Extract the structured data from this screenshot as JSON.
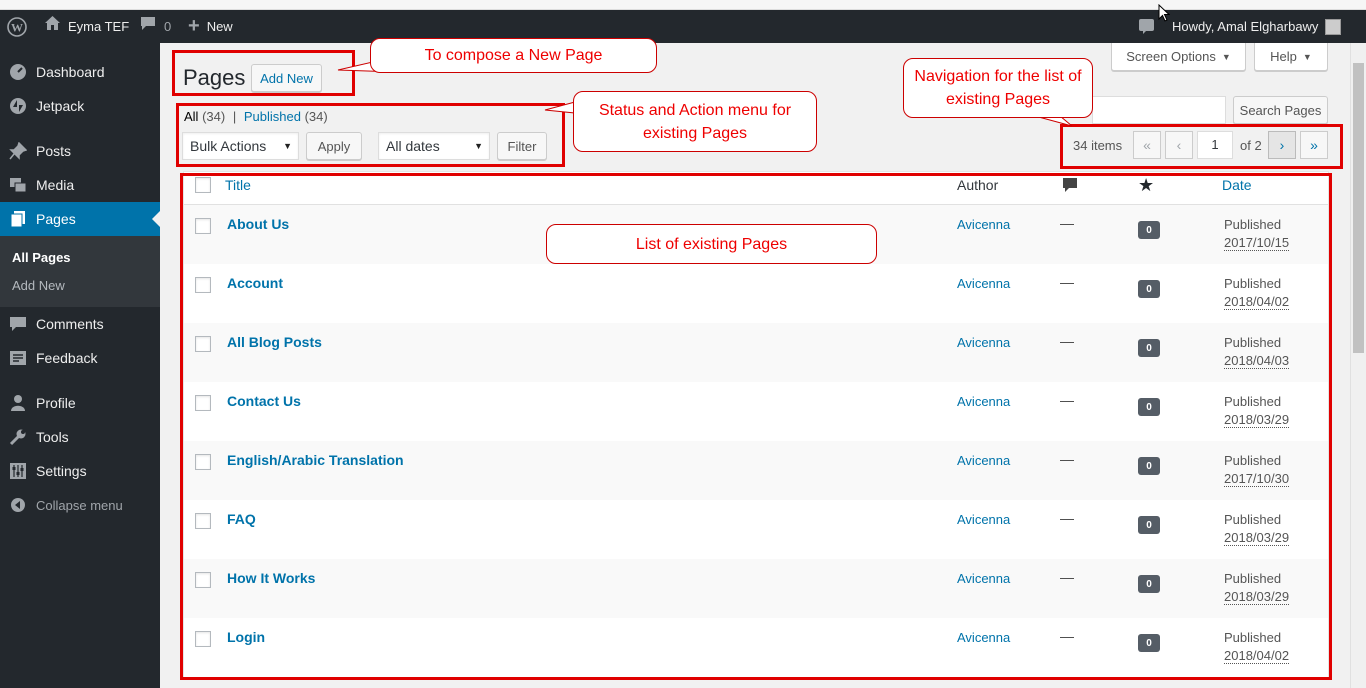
{
  "admin_bar": {
    "site_name": "Eyma TEF",
    "comments_count": "0",
    "new_label": "New",
    "howdy": "Howdy, Amal Elgharbawy"
  },
  "sidebar": {
    "items": [
      {
        "label": "Dashboard",
        "icon": "dashboard-icon"
      },
      {
        "label": "Jetpack",
        "icon": "jetpack-icon"
      },
      {
        "label": "Posts",
        "icon": "pin-icon"
      },
      {
        "label": "Media",
        "icon": "media-icon"
      },
      {
        "label": "Pages",
        "icon": "pages-icon"
      },
      {
        "label": "Comments",
        "icon": "comment-icon"
      },
      {
        "label": "Feedback",
        "icon": "feedback-icon"
      },
      {
        "label": "Profile",
        "icon": "user-icon"
      },
      {
        "label": "Tools",
        "icon": "wrench-icon"
      },
      {
        "label": "Settings",
        "icon": "settings-icon"
      }
    ],
    "submenu": {
      "all_pages": "All Pages",
      "add_new": "Add New"
    },
    "collapse_label": "Collapse menu"
  },
  "header": {
    "title": "Pages",
    "add_new": "Add New",
    "screen_options": "Screen Options",
    "help": "Help"
  },
  "filters": {
    "all_label": "All",
    "all_count": "(34)",
    "separator": "|",
    "published_label": "Published",
    "published_count": "(34)",
    "bulk_actions": "Bulk Actions",
    "apply": "Apply",
    "all_dates": "All dates",
    "filter": "Filter",
    "search_button": "Search Pages"
  },
  "pagination": {
    "items": "34 items",
    "first": "«",
    "prev": "‹",
    "current": "1",
    "of": "of 2",
    "next": "›",
    "last": "»"
  },
  "table": {
    "col_title": "Title",
    "col_author": "Author",
    "col_date": "Date",
    "rows": [
      {
        "title": "About Us",
        "author": "Avicenna",
        "comments": "—",
        "likes": "0",
        "status": "Published",
        "date": "2017/10/15"
      },
      {
        "title": "Account",
        "author": "Avicenna",
        "comments": "—",
        "likes": "0",
        "status": "Published",
        "date": "2018/04/02"
      },
      {
        "title": "All Blog Posts",
        "author": "Avicenna",
        "comments": "—",
        "likes": "0",
        "status": "Published",
        "date": "2018/04/03"
      },
      {
        "title": "Contact Us",
        "author": "Avicenna",
        "comments": "—",
        "likes": "0",
        "status": "Published",
        "date": "2018/03/29"
      },
      {
        "title": "English/Arabic Translation",
        "author": "Avicenna",
        "comments": "—",
        "likes": "0",
        "status": "Published",
        "date": "2017/10/30"
      },
      {
        "title": "FAQ",
        "author": "Avicenna",
        "comments": "—",
        "likes": "0",
        "status": "Published",
        "date": "2018/03/29"
      },
      {
        "title": "How It Works",
        "author": "Avicenna",
        "comments": "—",
        "likes": "0",
        "status": "Published",
        "date": "2018/03/29"
      },
      {
        "title": "Login",
        "author": "Avicenna",
        "comments": "—",
        "likes": "0",
        "status": "Published",
        "date": "2018/04/02"
      }
    ]
  },
  "callouts": {
    "compose": "To compose a New Page",
    "status_menu": "Status and Action menu for existing Pages",
    "navigation": "Navigation for the list of existing Pages",
    "list": "List of existing Pages"
  },
  "colors": {
    "admin_dark": "#23282d",
    "accent": "#0073aa",
    "annotation_red": "#e00000"
  }
}
